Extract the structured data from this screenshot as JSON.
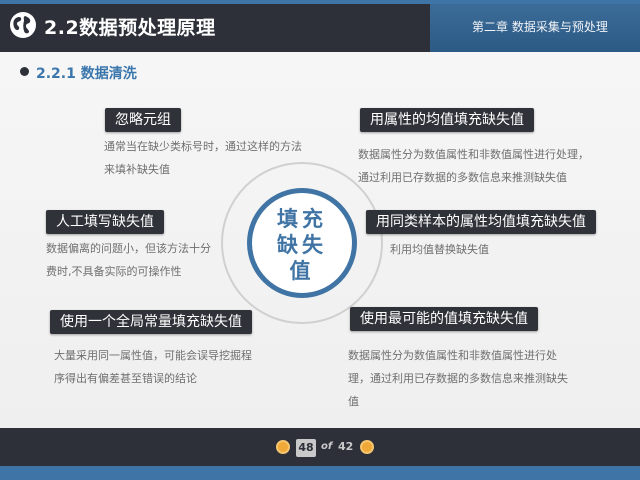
{
  "header": {
    "title": "2.2数据预处理原理",
    "chapter": "第二章 数据采集与预处理"
  },
  "section": {
    "title": "2.2.1 数据清洗"
  },
  "center": {
    "text": "填充缺失值"
  },
  "methods": [
    {
      "label": "忽略元组",
      "description": [
        "通常当在缺少类标号时，通过这样的方法",
        "来填补缺失值"
      ]
    },
    {
      "label": "用属性的均值填充缺失值",
      "description": [
        "数据属性分为数值属性和非数值属性进行处理，",
        "通过利用已存数据的多数信息来推测缺失值"
      ]
    },
    {
      "label": "人工填写缺失值",
      "description": [
        "数据偏离的问题小，但该方法十分",
        "费时,不具备实际的可操作性"
      ]
    },
    {
      "label": "用同类样本的属性均值填充缺失值",
      "description": [
        "利用均值替换缺失值"
      ]
    },
    {
      "label": "使用一个全局常量填充缺失值",
      "description": [
        "大量采用同一属性值，可能会误导挖掘程",
        "序得出有偏差甚至错误的结论"
      ]
    },
    {
      "label": "使用最可能的值填充缺失值",
      "description": [
        "数据属性分为数值属性和非数值属性进行处",
        "理，通过利用已存数据的多数信息来推测缺失",
        "值"
      ]
    }
  ],
  "footer": {
    "current_page": "48",
    "of_label": "of",
    "total_pages": "42"
  },
  "colors": {
    "accent": "#3f74a4",
    "dark": "#2d3038",
    "nav_button": "#f0a836"
  }
}
